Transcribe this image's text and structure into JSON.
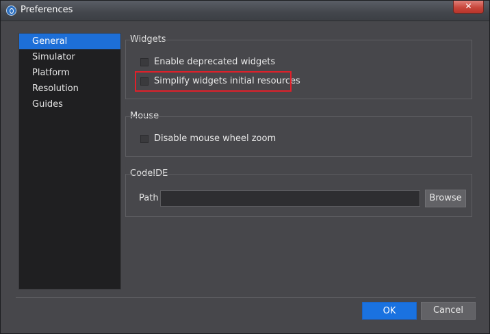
{
  "window": {
    "title": "Preferences",
    "close_glyph": "✕"
  },
  "sidebar": {
    "items": [
      {
        "label": "General",
        "selected": true
      },
      {
        "label": "Simulator",
        "selected": false
      },
      {
        "label": "Platform",
        "selected": false
      },
      {
        "label": "Resolution",
        "selected": false
      },
      {
        "label": "Guides",
        "selected": false
      }
    ]
  },
  "widgets": {
    "title": "Widgets",
    "enable_deprecated": {
      "label": "Enable deprecated widgets",
      "checked": false
    },
    "simplify_resources": {
      "label": "Simplify widgets initial resources",
      "checked": false,
      "highlighted": true
    }
  },
  "mouse": {
    "title": "Mouse",
    "disable_wheel_zoom": {
      "label": "Disable mouse wheel zoom",
      "checked": false
    }
  },
  "codeide": {
    "title": "CodeIDE",
    "path_label": "Path",
    "path_value": "",
    "browse_label": "Browse"
  },
  "footer": {
    "ok_label": "OK",
    "cancel_label": "Cancel"
  },
  "colors": {
    "accent": "#1d6fd8",
    "highlight_border": "#e0202a"
  }
}
